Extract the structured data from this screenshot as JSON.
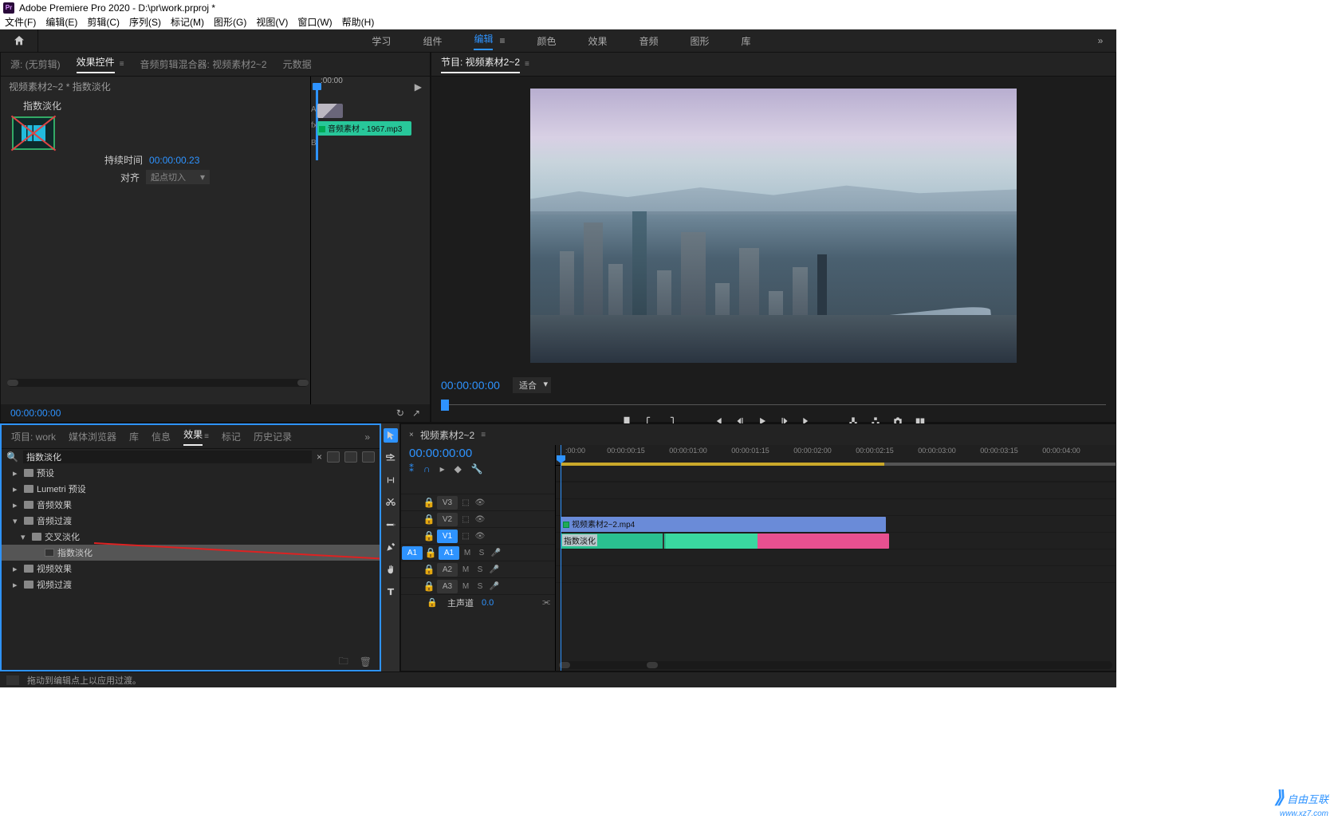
{
  "title": "Adobe Premiere Pro 2020 - D:\\pr\\work.prproj *",
  "menubar": [
    "文件(F)",
    "编辑(E)",
    "剪辑(C)",
    "序列(S)",
    "标记(M)",
    "图形(G)",
    "视图(V)",
    "窗口(W)",
    "帮助(H)"
  ],
  "workspaces": [
    "学习",
    "组件",
    "编辑",
    "颜色",
    "效果",
    "音频",
    "图形",
    "库"
  ],
  "active_workspace": 2,
  "source": {
    "tabs": [
      "源: (无剪辑)",
      "效果控件",
      "音频剪辑混合器: 视频素材2~2",
      "元数据"
    ],
    "active": 1,
    "clip_title": "视频素材2~2 * 指数淡化",
    "effect_name": "指数淡化",
    "duration_label": "持续时间",
    "duration_value": "00:00:00.23",
    "align_label": "对齐",
    "align_value": "起点切入",
    "mini_tc": ":00:00",
    "mini_ab": {
      "a": "A",
      "fx": "fx",
      "b": "B"
    },
    "mini_clip_label": "音频素材 - 1967.mp3",
    "footer_tc": "00:00:00:00"
  },
  "program": {
    "tab": "节目: 视频素材2~2",
    "tc": "00:00:00:00",
    "fit_label": "适合"
  },
  "project": {
    "tabs": [
      "项目: work",
      "媒体浏览器",
      "库",
      "信息",
      "效果",
      "标记",
      "历史记录"
    ],
    "active": 4,
    "search_value": "指数淡化",
    "tree": [
      {
        "label": "预设",
        "lvl": 0,
        "open": false,
        "icon": "folder"
      },
      {
        "label": "Lumetri 预设",
        "lvl": 0,
        "open": false,
        "icon": "folder"
      },
      {
        "label": "音频效果",
        "lvl": 0,
        "open": false,
        "icon": "folder"
      },
      {
        "label": "音频过渡",
        "lvl": 0,
        "open": true,
        "icon": "folder"
      },
      {
        "label": "交叉淡化",
        "lvl": 1,
        "open": true,
        "icon": "folder"
      },
      {
        "label": "指数淡化",
        "lvl": 2,
        "open": null,
        "icon": "fx",
        "selected": true
      },
      {
        "label": "视频效果",
        "lvl": 0,
        "open": false,
        "icon": "folder"
      },
      {
        "label": "视频过渡",
        "lvl": 0,
        "open": false,
        "icon": "folder"
      }
    ]
  },
  "timeline": {
    "sequence": "视频素材2~2",
    "tc": "00:00:00:00",
    "ruler": [
      ":00:00",
      "00:00:00:15",
      "00:00:01:00",
      "00:00:01:15",
      "00:00:02:00",
      "00:00:02:15",
      "00:00:03:00",
      "00:00:03:15",
      "00:00:04:00"
    ],
    "tracks_v": [
      {
        "name": "V3",
        "src": false,
        "tgt": false
      },
      {
        "name": "V2",
        "src": false,
        "tgt": false
      },
      {
        "name": "V1",
        "src": false,
        "tgt": true
      }
    ],
    "tracks_a": [
      {
        "name": "A1",
        "src": true,
        "tgt": true
      },
      {
        "name": "A2",
        "src": false,
        "tgt": false
      },
      {
        "name": "A3",
        "src": false,
        "tgt": false
      }
    ],
    "master_label": "主声道",
    "master_value": "0.0",
    "video_clip": "视频素材2~2.mp4",
    "audio_fade_label": "指数淡化"
  },
  "status": "拖动到编辑点上以应用过渡。",
  "watermark": {
    "brand": "自由互联",
    "url": "www.xz7.com"
  }
}
